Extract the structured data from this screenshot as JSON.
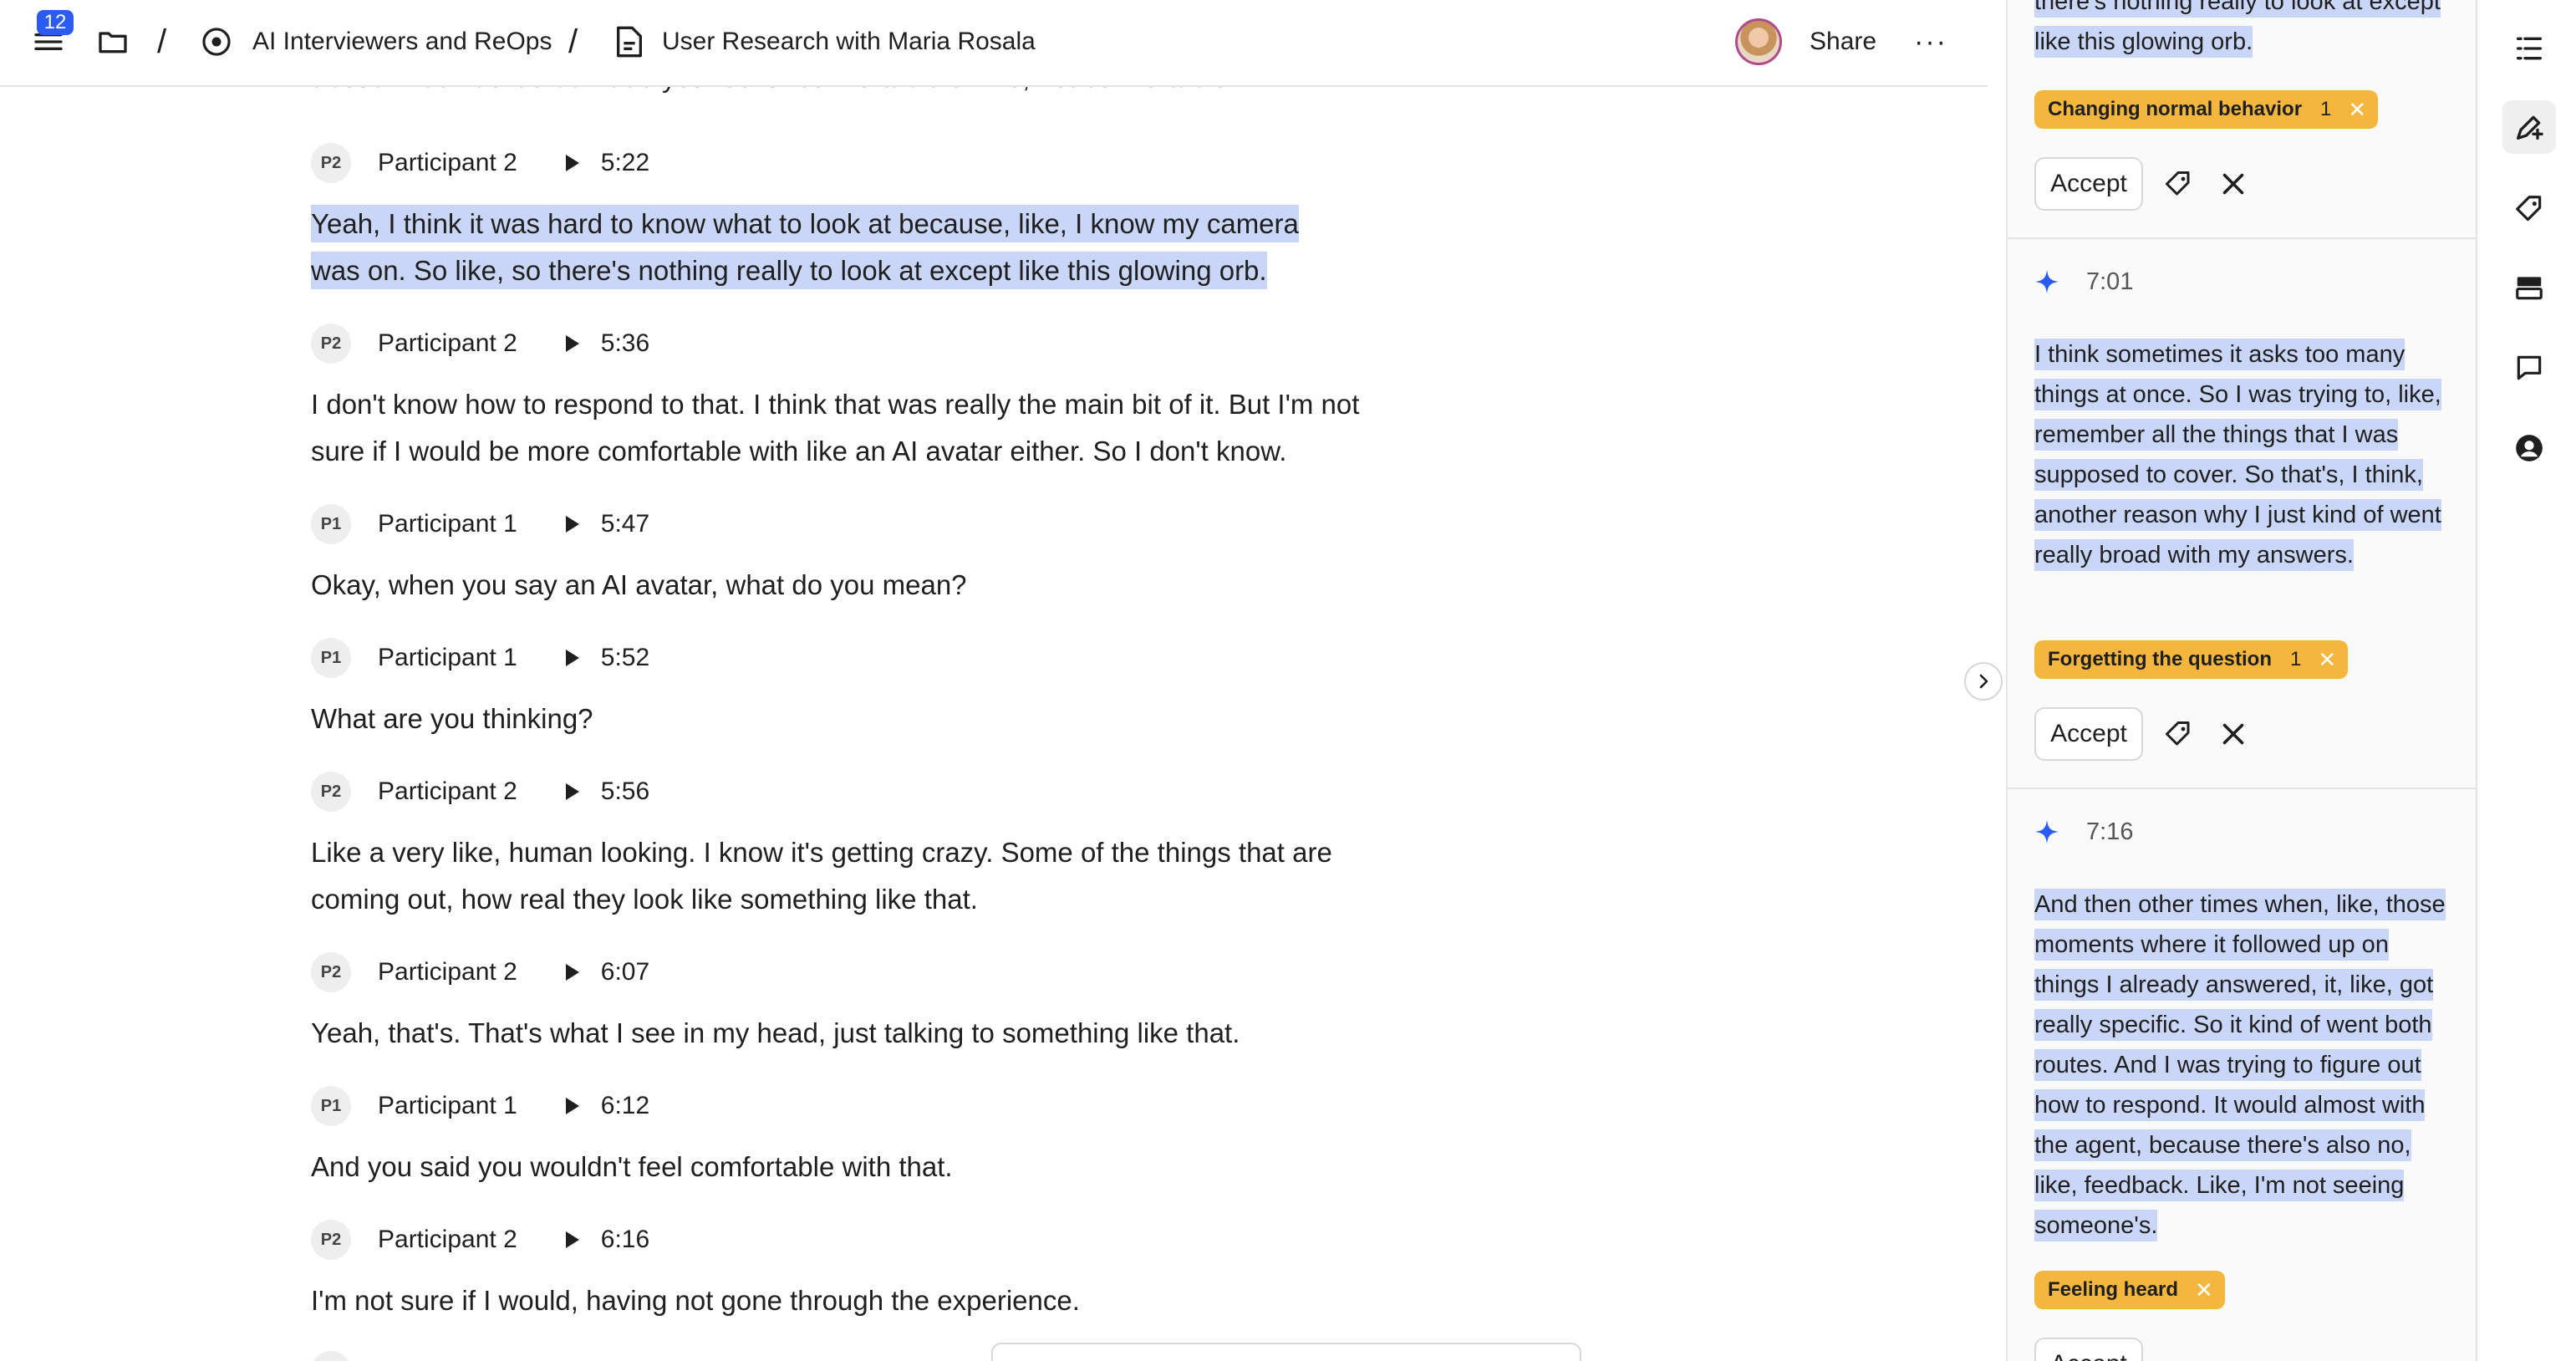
{
  "topbar": {
    "notification_count": "12",
    "breadcrumb": [
      "AI Interviewers and ReOps",
      "User Research with Maria Rosala"
    ],
    "separator": "/",
    "share_label": "Share",
    "more_label": "···"
  },
  "transcript": {
    "cut_line": "about what was it that made you feel uncomfortable or like, not comfortable in?",
    "entries": [
      {
        "badge": "P2",
        "speaker": "Participant 2",
        "time": "5:22",
        "text": "Yeah, I think it was hard to know what to look at because, like, I know my camera was on. So like, so there's nothing really to look at except like this glowing orb.",
        "highlighted": true
      },
      {
        "badge": "P2",
        "speaker": "Participant 2",
        "time": "5:36",
        "text": "I don't know how to respond to that. I think that was really the main bit of it. But I'm not sure if I would be more comfortable with like an AI avatar either. So I don't know.",
        "highlighted": false
      },
      {
        "badge": "P1",
        "speaker": "Participant 1",
        "time": "5:47",
        "text": "Okay, when you say an AI avatar, what do you mean?",
        "highlighted": false
      },
      {
        "badge": "P1",
        "speaker": "Participant 1",
        "time": "5:52",
        "text": "What are you thinking?",
        "highlighted": false
      },
      {
        "badge": "P2",
        "speaker": "Participant 2",
        "time": "5:56",
        "text": "Like a very like, human looking. I know it's getting crazy. Some of the things that are coming out, how real they look like something like that.",
        "highlighted": false
      },
      {
        "badge": "P2",
        "speaker": "Participant 2",
        "time": "6:07",
        "text": "Yeah, that's. That's what I see in my head, just talking to something like that.",
        "highlighted": false
      },
      {
        "badge": "P1",
        "speaker": "Participant 1",
        "time": "6:12",
        "text": "And you said you wouldn't feel comfortable with that.",
        "highlighted": false
      },
      {
        "badge": "P2",
        "speaker": "Participant 2",
        "time": "6:16",
        "text": "I'm not sure if I would, having not gone through the experience.",
        "highlighted": false
      }
    ]
  },
  "suggestions": {
    "accept_label": "Accept",
    "cards": [
      {
        "time": "",
        "quote": "there's nothing really to look at except like this glowing orb.",
        "tag": "Changing normal behavior",
        "tag_count": "1"
      },
      {
        "time": "7:01",
        "quote": "I think sometimes it asks too many things at once. So I was trying to, like, remember all the things that I was supposed to cover. So that's, I think, another reason why I just kind of went really broad with my answers.",
        "tag": "Forgetting the question",
        "tag_count": "1"
      },
      {
        "time": "7:16",
        "quote": "And then other times when, like, those moments where it followed up on things I already answered, it, like, got really specific. So it kind of went both routes. And I was trying to figure out how to respond. It would almost with the agent, because there's also no, like, feedback. Like, I'm not seeing someone's.",
        "tag": "Feeling heard",
        "tag_count": ""
      }
    ]
  },
  "colors": {
    "highlight": "#c9d6f7",
    "tag": "#f4b63d",
    "accent": "#2b5bf0"
  },
  "icons": {
    "rail": [
      "outline-list-icon",
      "ai-highlight-icon",
      "tag-icon",
      "table-icon",
      "comment-icon",
      "user-icon"
    ]
  }
}
